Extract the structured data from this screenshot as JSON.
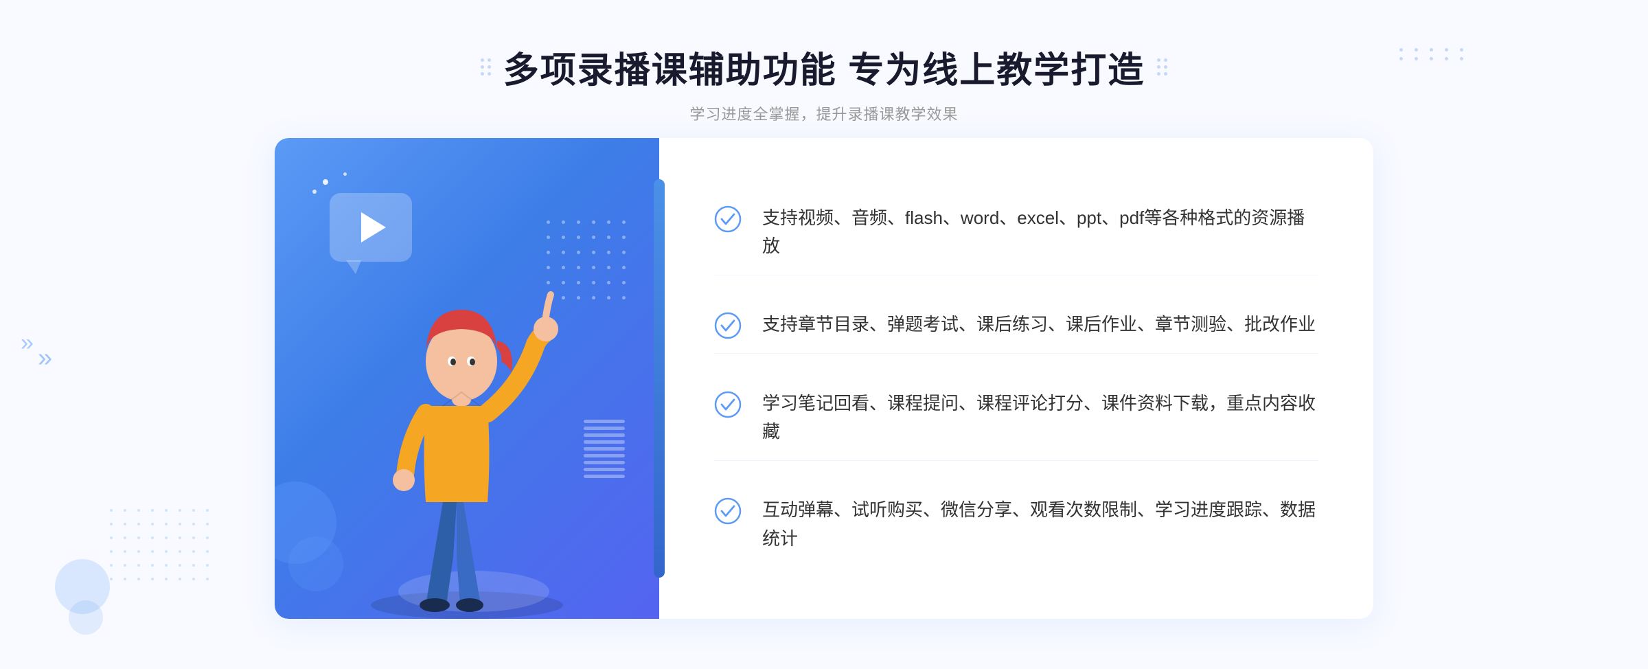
{
  "page": {
    "background": "#f8faff"
  },
  "header": {
    "title": "多项录播课辅助功能 专为线上教学打造",
    "subtitle": "学习进度全掌握，提升录播课教学效果"
  },
  "features": [
    {
      "id": "feature-1",
      "text": "支持视频、音频、flash、word、excel、ppt、pdf等各种格式的资源播放"
    },
    {
      "id": "feature-2",
      "text": "支持章节目录、弹题考试、课后练习、课后作业、章节测验、批改作业"
    },
    {
      "id": "feature-3",
      "text": "学习笔记回看、课程提问、课程评论打分、课件资料下载，重点内容收藏"
    },
    {
      "id": "feature-4",
      "text": "互动弹幕、试听购买、微信分享、观看次数限制、学习进度跟踪、数据统计"
    }
  ],
  "colors": {
    "primary": "#3d7de8",
    "primary_light": "#5b9af5",
    "text_dark": "#1a1a2e",
    "text_gray": "#999999",
    "text_body": "#333333",
    "check_color": "#5b9af5",
    "bg_light": "#f8faff"
  }
}
